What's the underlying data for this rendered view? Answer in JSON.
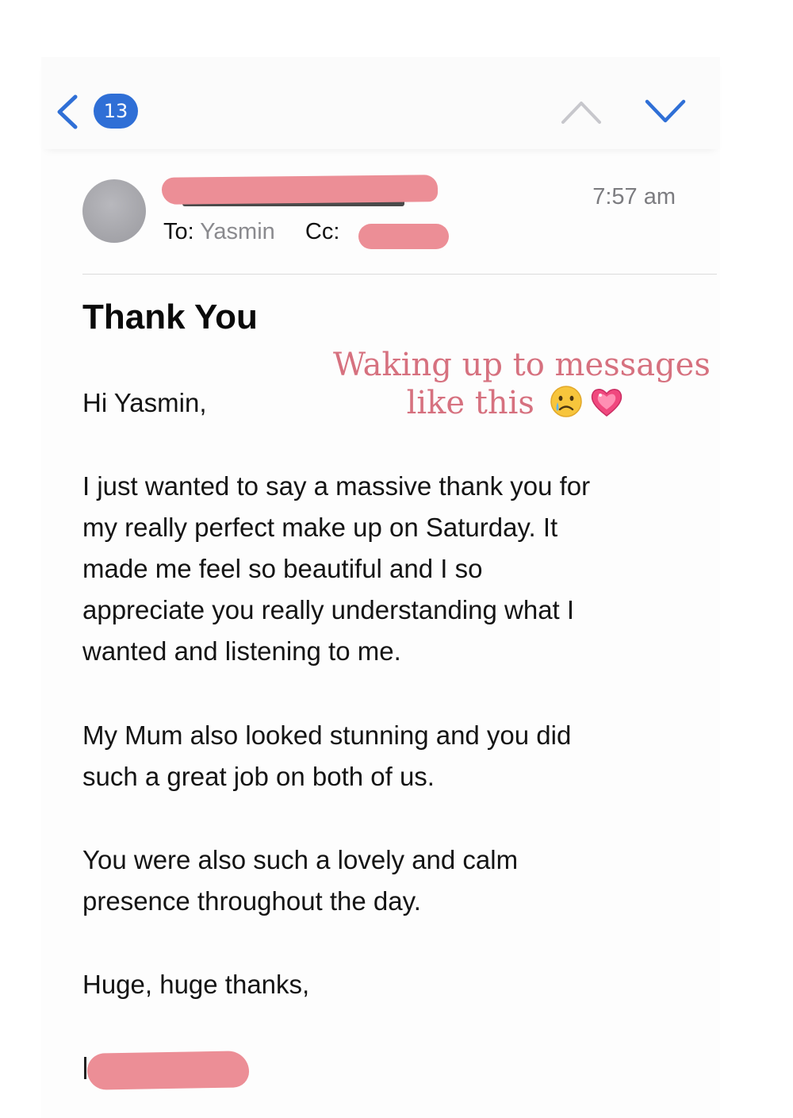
{
  "navbar": {
    "unread_count": "13",
    "back_icon": "chevron-left-icon",
    "prev_icon": "chevron-up-icon",
    "next_icon": "chevron-down-icon",
    "accent_color": "#2f6fd6"
  },
  "header": {
    "to_label": "To:",
    "to_value": "Yasmin",
    "cc_label": "Cc:",
    "time": "7:57 am"
  },
  "subject": "Thank You",
  "overlay": {
    "line1": "Waking up to messages",
    "line2": "like this",
    "emojis": [
      "crying-face-icon",
      "sparkling-heart-icon"
    ],
    "color": "#d6717f"
  },
  "body": {
    "greeting": "Hi Yasmin,",
    "paragraph1": [
      "I just wanted to say a massive thank you for",
      "my really perfect make up on Saturday. It",
      "made me feel so beautiful and I so",
      "appreciate you really understanding what I",
      "wanted and listening to me."
    ],
    "paragraph2": [
      "My Mum also looked stunning and you did",
      "such a great job on both of us."
    ],
    "paragraph3": [
      "You were also such a lovely and calm",
      "presence throughout the day."
    ],
    "closing": "Huge, huge thanks,"
  },
  "redaction_color": "#ec8e96"
}
